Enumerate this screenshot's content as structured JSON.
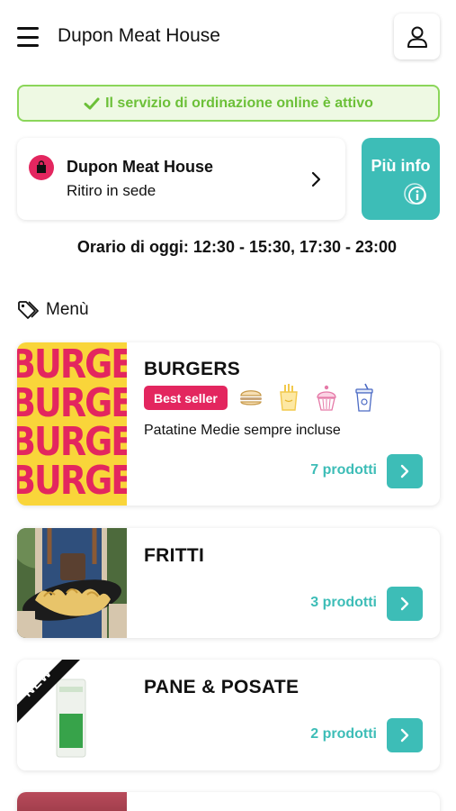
{
  "header": {
    "title": "Dupon Meat House"
  },
  "status": {
    "text": "Il servizio di ordinazione online è attivo"
  },
  "store": {
    "name": "Dupon Meat House",
    "mode": "Ritiro in sede"
  },
  "info_button": {
    "label": "Più info"
  },
  "hours": {
    "text": "Orario di oggi: 12:30 - 15:30, 17:30 - 23:00"
  },
  "menu": {
    "heading": "Menù",
    "categories": [
      {
        "title": "BURGERS",
        "badge": "Best seller",
        "icons": [
          "burger-icon",
          "fries-icon",
          "cupcake-icon",
          "drink-cup-icon"
        ],
        "description": "Patatine Medie sempre incluse",
        "count": "7 prodotti",
        "image_text": "BURGERS"
      },
      {
        "title": "FRITTI",
        "count": "3 prodotti"
      },
      {
        "title": "PANE & POSATE",
        "count": "2 prodotti",
        "ribbon": "NEW"
      }
    ]
  },
  "colors": {
    "accent": "#3dbdb7",
    "brand": "#e3265f",
    "success": "#6cc038"
  }
}
